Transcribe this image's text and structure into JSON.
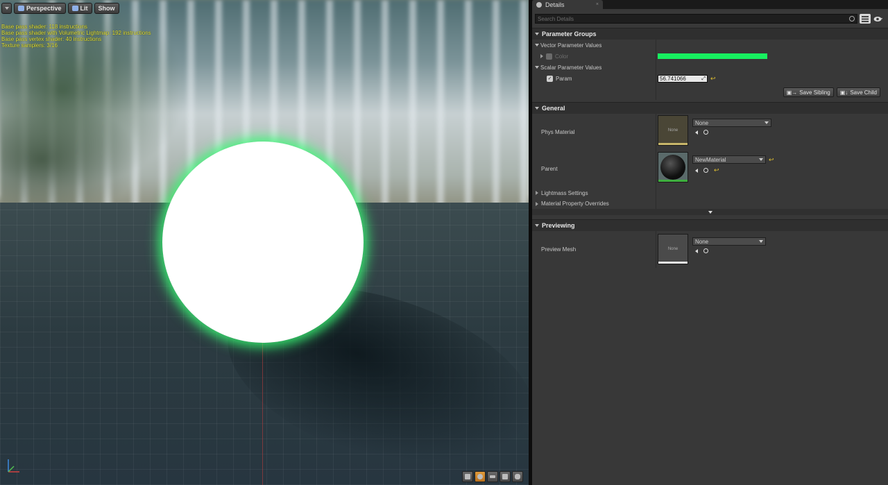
{
  "viewport": {
    "toolbar": {
      "perspective_label": "Perspective",
      "lit_label": "Lit",
      "show_label": "Show"
    },
    "stats": [
      "Base pass shader: 118 instructions",
      "Base pass shader with Volumetric Lightmap: 192 instructions",
      "Base pass vertex shader: 40 instructions",
      "Texture samplers: 3/16"
    ],
    "sphere_color": "#2ee86a"
  },
  "details": {
    "tab_title": "Details",
    "search_placeholder": "Search Details",
    "parameter_groups": {
      "title": "Parameter Groups",
      "vector_title": "Vector Parameter Values",
      "color_label": "Color",
      "color_value": "#17f060",
      "scalar_title": "Scalar Parameter Values",
      "param_label": "Param",
      "param_value": "56.741066",
      "save_sibling_label": "Save Sibling",
      "save_child_label": "Save Child"
    },
    "general": {
      "title": "General",
      "phys_material_label": "Phys Material",
      "phys_material_thumb": "None",
      "phys_material_value": "None",
      "parent_label": "Parent",
      "parent_value": "NewMaterial",
      "lightmass_label": "Lightmass Settings",
      "overrides_label": "Material Property Overrides"
    },
    "previewing": {
      "title": "Previewing",
      "preview_mesh_label": "Preview Mesh",
      "preview_mesh_thumb": "None",
      "preview_mesh_value": "None"
    }
  }
}
